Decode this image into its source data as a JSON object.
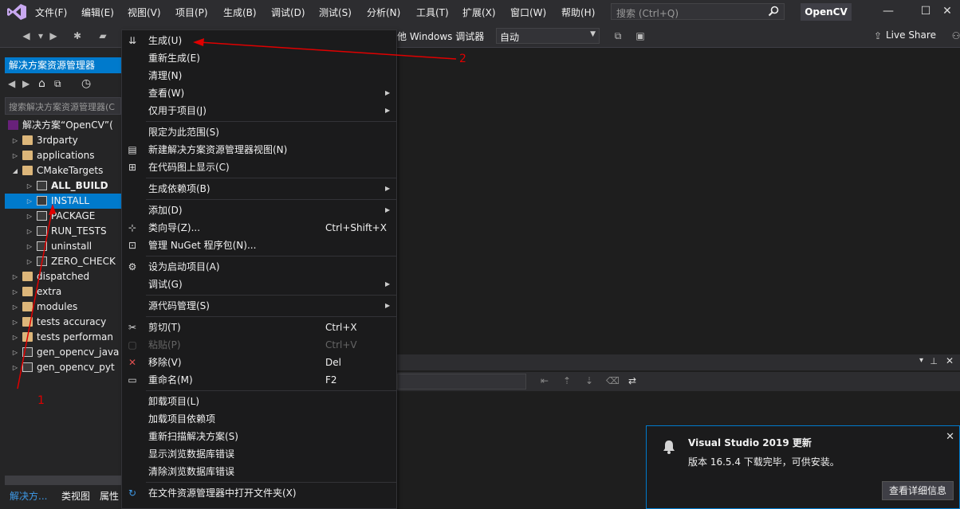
{
  "title_bar": {
    "menus": [
      "文件(F)",
      "编辑(E)",
      "视图(V)",
      "项目(P)",
      "生成(B)",
      "调试(D)",
      "测试(S)",
      "分析(N)",
      "工具(T)",
      "扩展(X)",
      "窗口(W)",
      "帮助(H)"
    ],
    "search_placeholder": "搜索 (Ctrl+Q)",
    "project_name": "OpenCV"
  },
  "toolbar": {
    "debugger_label": "他 Windows 调试器",
    "configuration": "自动",
    "live_share": "Live Share"
  },
  "solution_explorer": {
    "title": "解决方案资源管理器",
    "search_placeholder": "搜索解决方案资源管理器(C",
    "tree": [
      {
        "label": "解决方案“OpenCV”(",
        "icon": "solution-icon"
      },
      {
        "label": "3rdparty",
        "icon": "folder-icon"
      },
      {
        "label": "applications",
        "icon": "folder-icon"
      },
      {
        "label": "CMakeTargets",
        "icon": "folder-icon"
      },
      {
        "label": "ALL_BUILD",
        "icon": "project-icon"
      },
      {
        "label": "INSTALL",
        "icon": "project-icon"
      },
      {
        "label": "PACKAGE",
        "icon": "project-icon"
      },
      {
        "label": "RUN_TESTS",
        "icon": "project-icon"
      },
      {
        "label": "uninstall",
        "icon": "project-icon"
      },
      {
        "label": "ZERO_CHECK",
        "icon": "project-icon"
      },
      {
        "label": "dispatched",
        "icon": "folder-icon"
      },
      {
        "label": "extra",
        "icon": "folder-icon"
      },
      {
        "label": "modules",
        "icon": "folder-icon"
      },
      {
        "label": "tests accuracy",
        "icon": "folder-icon"
      },
      {
        "label": "tests performan",
        "icon": "folder-icon"
      },
      {
        "label": "gen_opencv_java",
        "icon": "project-icon"
      },
      {
        "label": "gen_opencv_pyt",
        "icon": "project-icon"
      }
    ],
    "bottom_tabs": [
      "解决方...",
      "类视图",
      "属性"
    ]
  },
  "context_menu": {
    "items": [
      {
        "label": "生成(U)",
        "icon": "build-icon"
      },
      {
        "label": "重新生成(E)"
      },
      {
        "label": "清理(N)"
      },
      {
        "label": "查看(W)",
        "submenu": true
      },
      {
        "label": "仅用于项目(J)",
        "submenu": true
      },
      {
        "label": "限定为此范围(S)"
      },
      {
        "label": "新建解决方案资源管理器视图(N)",
        "icon": "new-view-icon"
      },
      {
        "label": "在代码图上显示(C)",
        "icon": "code-map-icon"
      },
      {
        "label": "生成依赖项(B)",
        "submenu": true
      },
      {
        "label": "添加(D)",
        "submenu": true
      },
      {
        "label": "类向导(Z)...",
        "shortcut": "Ctrl+Shift+X",
        "icon": "class-wizard-icon"
      },
      {
        "label": "管理 NuGet 程序包(N)...",
        "icon": "nuget-icon"
      },
      {
        "label": "设为启动项目(A)",
        "icon": "gear-icon"
      },
      {
        "label": "调试(G)",
        "submenu": true
      },
      {
        "label": "源代码管理(S)",
        "submenu": true
      },
      {
        "label": "剪切(T)",
        "shortcut": "Ctrl+X",
        "icon": "scissors-icon"
      },
      {
        "label": "粘贴(P)",
        "shortcut": "Ctrl+V",
        "disabled": true,
        "icon": "paste-icon"
      },
      {
        "label": "移除(V)",
        "shortcut": "Del",
        "icon": "remove-icon"
      },
      {
        "label": "重命名(M)",
        "shortcut": "F2",
        "icon": "rename-icon"
      },
      {
        "label": "卸载项目(L)"
      },
      {
        "label": "加载项目依赖项"
      },
      {
        "label": "重新扫描解决方案(S)"
      },
      {
        "label": "显示浏览数据库错误"
      },
      {
        "label": "清除浏览数据库错误"
      },
      {
        "label": "在文件资源管理器中打开文件夹(X)",
        "icon": "open-folder-icon"
      }
    ]
  },
  "notification": {
    "title": "Visual Studio 2019 更新",
    "message": "版本 16.5.4 下载完毕，可供安装。",
    "button": "查看详细信息"
  },
  "annotations": {
    "label_1": "1",
    "label_2": "2",
    "color": "#e00000"
  },
  "colors": {
    "accent": "#007acc",
    "background": "#1e1e1e",
    "panel": "#252526",
    "chrome": "#2d2d30"
  }
}
